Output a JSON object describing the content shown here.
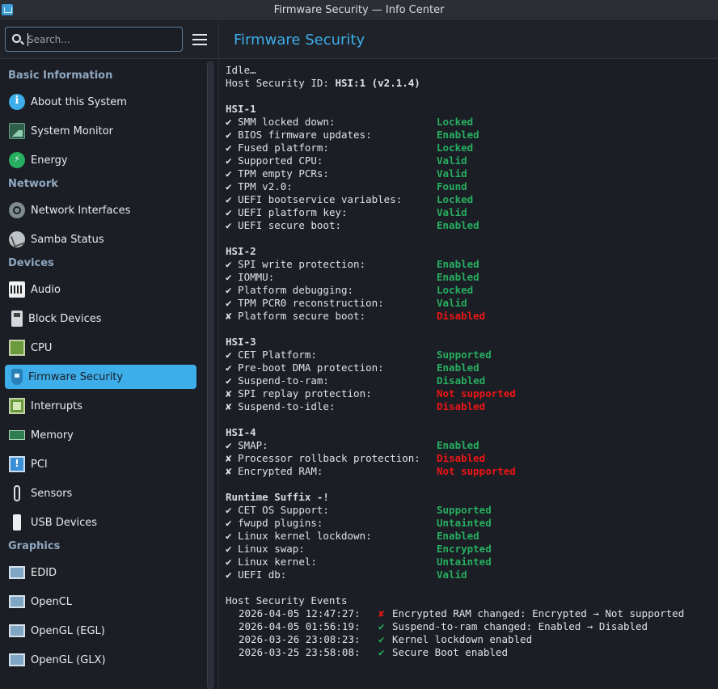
{
  "window": {
    "title": "Firmware Security — Info Center"
  },
  "search": {
    "placeholder": "Search..."
  },
  "page": {
    "title": "Firmware Security"
  },
  "sidebar": {
    "categories": [
      {
        "label": "Basic Information",
        "items": [
          "About this System",
          "System Monitor",
          "Energy"
        ]
      },
      {
        "label": "Network",
        "items": [
          "Network Interfaces",
          "Samba Status"
        ]
      },
      {
        "label": "Devices",
        "items": [
          "Audio",
          "Block Devices",
          "CPU",
          "Firmware Security",
          "Interrupts",
          "Memory",
          "PCI",
          "Sensors",
          "USB Devices"
        ]
      },
      {
        "label": "Graphics",
        "items": [
          "EDID",
          "OpenCL",
          "OpenGL (EGL)",
          "OpenGL (GLX)"
        ]
      }
    ],
    "selected": "Firmware Security"
  },
  "report": {
    "status": "Idle…",
    "host_id_label": "Host Security ID: ",
    "host_id_value": "HSI:1 (v2.1.4)",
    "sections": [
      {
        "title": "HSI-1",
        "rows": [
          {
            "mark": "✔",
            "label": "SMM locked down:",
            "value": "Locked",
            "ok": true
          },
          {
            "mark": "✔",
            "label": "BIOS firmware updates:",
            "value": "Enabled",
            "ok": true
          },
          {
            "mark": "✔",
            "label": "Fused platform:",
            "value": "Locked",
            "ok": true
          },
          {
            "mark": "✔",
            "label": "Supported CPU:",
            "value": "Valid",
            "ok": true
          },
          {
            "mark": "✔",
            "label": "TPM empty PCRs:",
            "value": "Valid",
            "ok": true
          },
          {
            "mark": "✔",
            "label": "TPM v2.0:",
            "value": "Found",
            "ok": true
          },
          {
            "mark": "✔",
            "label": "UEFI bootservice variables:",
            "value": "Locked",
            "ok": true
          },
          {
            "mark": "✔",
            "label": "UEFI platform key:",
            "value": "Valid",
            "ok": true
          },
          {
            "mark": "✔",
            "label": "UEFI secure boot:",
            "value": "Enabled",
            "ok": true
          }
        ]
      },
      {
        "title": "HSI-2",
        "rows": [
          {
            "mark": "✔",
            "label": "SPI write protection:",
            "value": "Enabled",
            "ok": true
          },
          {
            "mark": "✔",
            "label": "IOMMU:",
            "value": "Enabled",
            "ok": true
          },
          {
            "mark": "✔",
            "label": "Platform debugging:",
            "value": "Locked",
            "ok": true
          },
          {
            "mark": "✔",
            "label": "TPM PCR0 reconstruction:",
            "value": "Valid",
            "ok": true
          },
          {
            "mark": "✘",
            "label": "Platform secure boot:",
            "value": "Disabled",
            "ok": false
          }
        ]
      },
      {
        "title": "HSI-3",
        "rows": [
          {
            "mark": "✔",
            "label": "CET Platform:",
            "value": "Supported",
            "ok": true
          },
          {
            "mark": "✔",
            "label": "Pre-boot DMA protection:",
            "value": "Enabled",
            "ok": true
          },
          {
            "mark": "✔",
            "label": "Suspend-to-ram:",
            "value": "Disabled",
            "ok": true
          },
          {
            "mark": "✘",
            "label": "SPI replay protection:",
            "value": "Not supported",
            "ok": false
          },
          {
            "mark": "✘",
            "label": "Suspend-to-idle:",
            "value": "Disabled",
            "ok": false
          }
        ]
      },
      {
        "title": "HSI-4",
        "rows": [
          {
            "mark": "✔",
            "label": "SMAP:",
            "value": "Enabled",
            "ok": true
          },
          {
            "mark": "✘",
            "label": "Processor rollback protection:",
            "value": "Disabled",
            "ok": false
          },
          {
            "mark": "✘",
            "label": "Encrypted RAM:",
            "value": "Not supported",
            "ok": false
          }
        ]
      },
      {
        "title": "Runtime Suffix -!",
        "rows": [
          {
            "mark": "✔",
            "label": "CET OS Support:",
            "value": "Supported",
            "ok": true
          },
          {
            "mark": "✔",
            "label": "fwupd plugins:",
            "value": "Untainted",
            "ok": true
          },
          {
            "mark": "✔",
            "label": "Linux kernel lockdown:",
            "value": "Enabled",
            "ok": true
          },
          {
            "mark": "✔",
            "label": "Linux swap:",
            "value": "Encrypted",
            "ok": true
          },
          {
            "mark": "✔",
            "label": "Linux kernel:",
            "value": "Untainted",
            "ok": true
          },
          {
            "mark": "✔",
            "label": "UEFI db:",
            "value": "Valid",
            "ok": true
          }
        ]
      }
    ],
    "events_title": "Host Security Events",
    "events": [
      {
        "time": "2026-04-05 12:47:27:",
        "mark": "✘",
        "ok": false,
        "text": "Encrypted RAM changed: Encrypted → Not supported"
      },
      {
        "time": "2026-04-05 01:56:19:",
        "mark": "✔",
        "ok": true,
        "text": "Suspend-to-ram changed: Enabled → Disabled"
      },
      {
        "time": "2026-03-26 23:08:23:",
        "mark": "✔",
        "ok": true,
        "text": "Kernel lockdown enabled"
      },
      {
        "time": "2026-03-25 23:58:08:",
        "mark": "✔",
        "ok": true,
        "text": "Secure Boot enabled"
      }
    ]
  },
  "colors": {
    "accent": "#3daee9",
    "ok": "#27ae60",
    "bad": "#ed1515",
    "background": "#1b1e25"
  },
  "icons": {
    "About this System": "info-icon",
    "System Monitor": "system-monitor-icon",
    "Energy": "energy-icon",
    "Network Interfaces": "network-icon",
    "Samba Status": "samba-icon",
    "Audio": "audio-icon",
    "Block Devices": "block-device-icon",
    "CPU": "cpu-icon",
    "Firmware Security": "shield-icon",
    "Interrupts": "interrupts-icon",
    "Memory": "memory-icon",
    "PCI": "pci-icon",
    "Sensors": "thermometer-icon",
    "USB Devices": "usb-icon",
    "EDID": "display-icon",
    "OpenCL": "display-icon",
    "OpenGL (EGL)": "display-icon",
    "OpenGL (GLX)": "display-icon"
  }
}
